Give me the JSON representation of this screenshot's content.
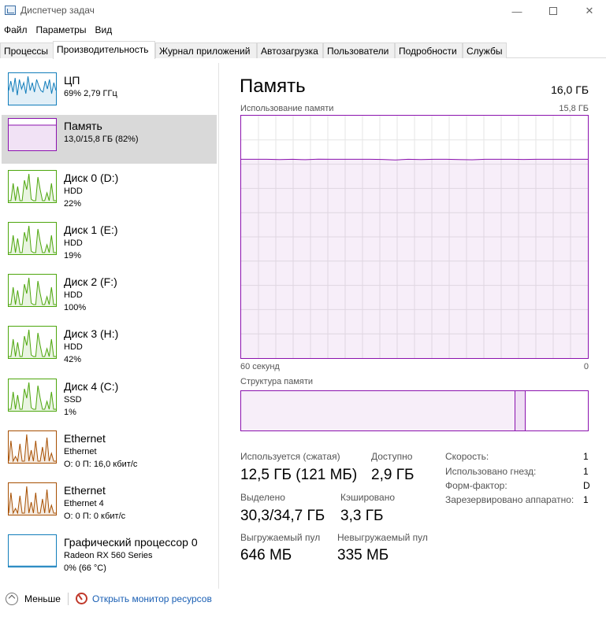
{
  "window": {
    "title": "Диспетчер задач",
    "minimize": "—",
    "close": "✕"
  },
  "menu": [
    "Файл",
    "Параметры",
    "Вид"
  ],
  "tabs": [
    "Процессы",
    "Производительность",
    "Журнал приложений",
    "Автозагрузка",
    "Пользователи",
    "Подробности",
    "Службы"
  ],
  "active_tab": "Производительность",
  "sidebar": [
    {
      "name": "ЦП",
      "lines": [
        "69% 2,79 ГГц"
      ],
      "color": "#117dbb",
      "icon": "cpu-graph"
    },
    {
      "name": "Память",
      "lines": [
        "13,0/15,8 ГБ (82%)"
      ],
      "color": "#8b12ae",
      "icon": "memory-graph",
      "selected": true
    },
    {
      "name": "Диск 0 (D:)",
      "lines": [
        "HDD",
        "22%"
      ],
      "color": "#4da60c",
      "icon": "disk-graph"
    },
    {
      "name": "Диск 1 (E:)",
      "lines": [
        "HDD",
        "19%"
      ],
      "color": "#4da60c",
      "icon": "disk-graph"
    },
    {
      "name": "Диск 2 (F:)",
      "lines": [
        "HDD",
        "100%"
      ],
      "color": "#4da60c",
      "icon": "disk-graph"
    },
    {
      "name": "Диск 3 (H:)",
      "lines": [
        "HDD",
        "42%"
      ],
      "color": "#4da60c",
      "icon": "disk-graph"
    },
    {
      "name": "Диск 4 (C:)",
      "lines": [
        "SSD",
        "1%"
      ],
      "color": "#4da60c",
      "icon": "disk-graph"
    },
    {
      "name": "Ethernet",
      "lines": [
        "Ethernet",
        "О: 0 П: 16,0 кбит/с"
      ],
      "color": "#a74f01",
      "icon": "network-graph"
    },
    {
      "name": "Ethernet",
      "lines": [
        "Ethernet 4",
        "О: 0 П: 0 кбит/с"
      ],
      "color": "#a74f01",
      "icon": "network-graph"
    },
    {
      "name": "Графический процессор 0",
      "lines": [
        "Radeon RX 560 Series",
        "0% (66 °C)"
      ],
      "color": "#117dbb",
      "icon": "gpu-graph"
    }
  ],
  "main": {
    "title": "Память",
    "total": "16,0 ГБ",
    "usage_label": "Использование памяти",
    "usage_max": "15,8 ГБ",
    "axis_left": "60 секунд",
    "axis_right": "0",
    "composition_label": "Структура памяти",
    "usage_fraction": 0.82,
    "composition": {
      "in_use_fraction": 0.79,
      "modified_fraction": 0.03
    },
    "accent_color": "#8b12ae",
    "stats": [
      {
        "label": "Используется (сжатая)",
        "value": "12,5 ГБ (121 МБ)"
      },
      {
        "label": "Доступно",
        "value": "2,9 ГБ"
      },
      {
        "label": "Выделено",
        "value": "30,3/34,7 ГБ"
      },
      {
        "label": "Кэшировано",
        "value": "3,3 ГБ"
      },
      {
        "label": "Выгружаемый пул",
        "value": "646 МБ"
      },
      {
        "label": "Невыгружаемый пул",
        "value": "335 МБ"
      }
    ],
    "properties": [
      {
        "label": "Скорость:",
        "value": "1"
      },
      {
        "label": "Использовано гнезд:",
        "value": "1"
      },
      {
        "label": "Форм-фактор:",
        "value": "D"
      },
      {
        "label": "Зарезервировано аппаратно:",
        "value": "1"
      }
    ]
  },
  "footer": {
    "fewer_details": "Меньше",
    "open_monitor": "Открыть монитор ресурсов"
  }
}
